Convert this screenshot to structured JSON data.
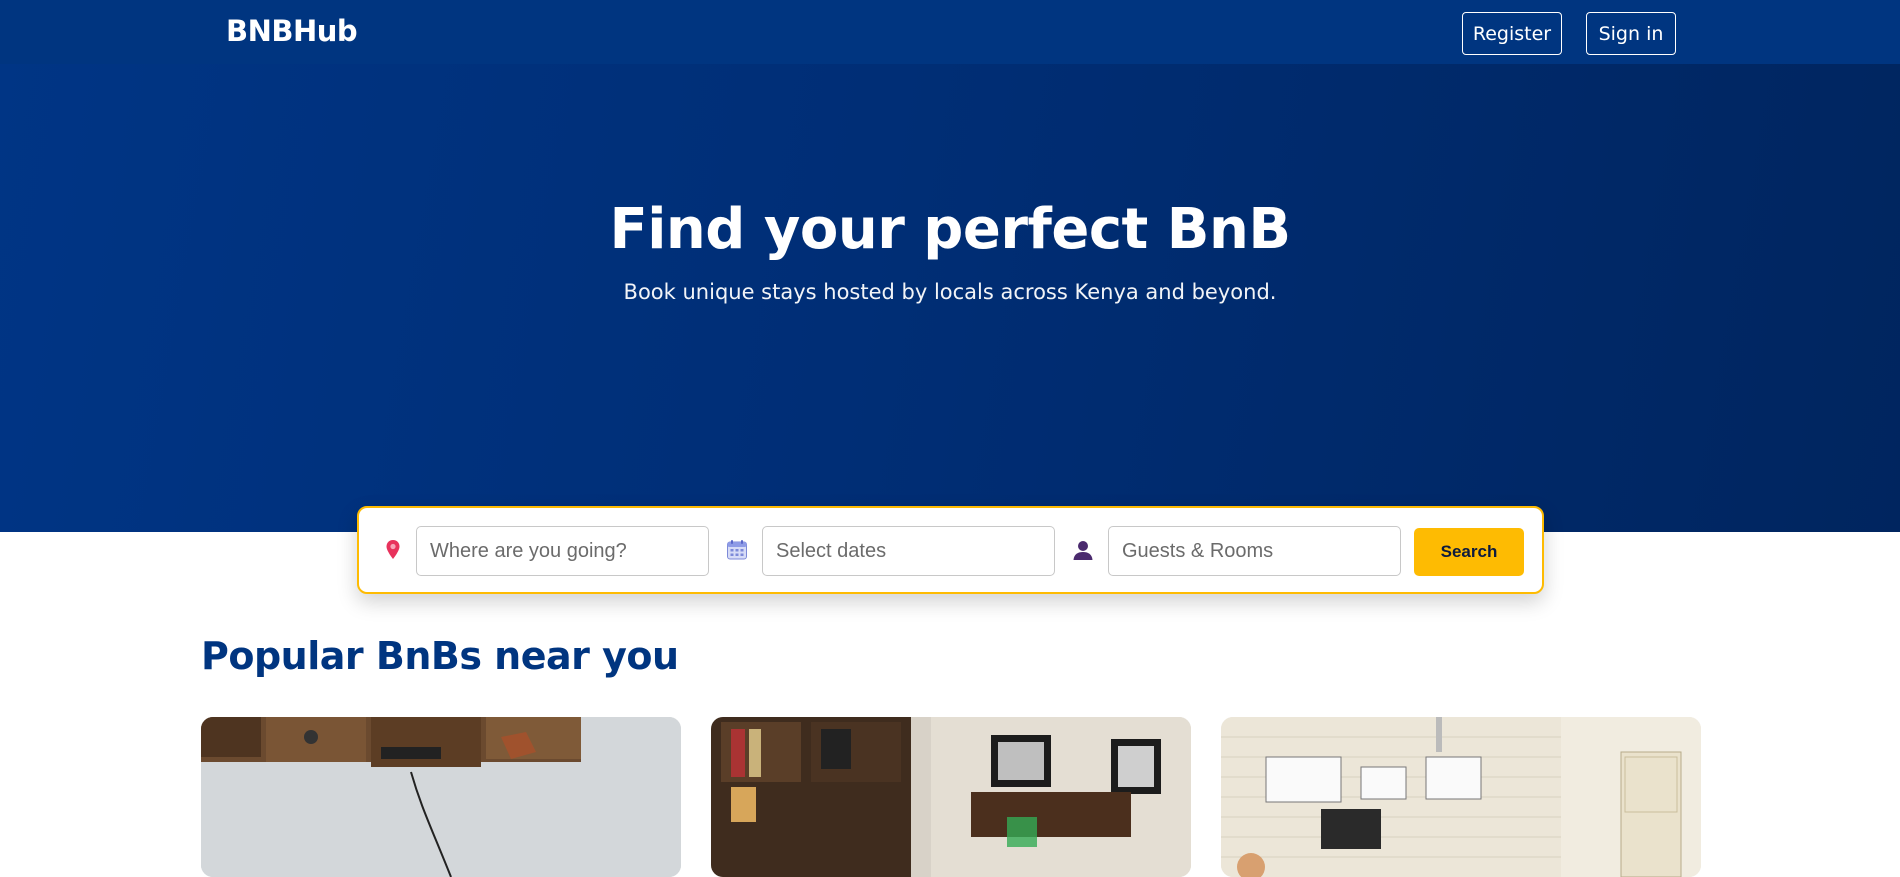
{
  "navbar": {
    "brand": "BNBHub",
    "register_label": "Register",
    "signin_label": "Sign in"
  },
  "hero": {
    "title": "Find your perfect BnB",
    "subtitle": "Book unique stays hosted by locals across Kenya and beyond."
  },
  "search": {
    "destination_placeholder": "Where are you going?",
    "dates_placeholder": "Select dates",
    "guests_placeholder": "Guests & Rooms",
    "button_label": "Search",
    "icons": [
      "location-pin-icon",
      "calendar-icon",
      "person-icon"
    ]
  },
  "popular": {
    "title": "Popular BnBs near you",
    "listings": [
      {
        "image": "listing-photo-shelves-wall"
      },
      {
        "image": "listing-photo-bookshelf-living-room"
      },
      {
        "image": "listing-photo-brick-wall-tv-room"
      }
    ]
  },
  "colors": {
    "brand_blue": "#003580",
    "accent_yellow": "#febb02",
    "white": "#ffffff"
  }
}
